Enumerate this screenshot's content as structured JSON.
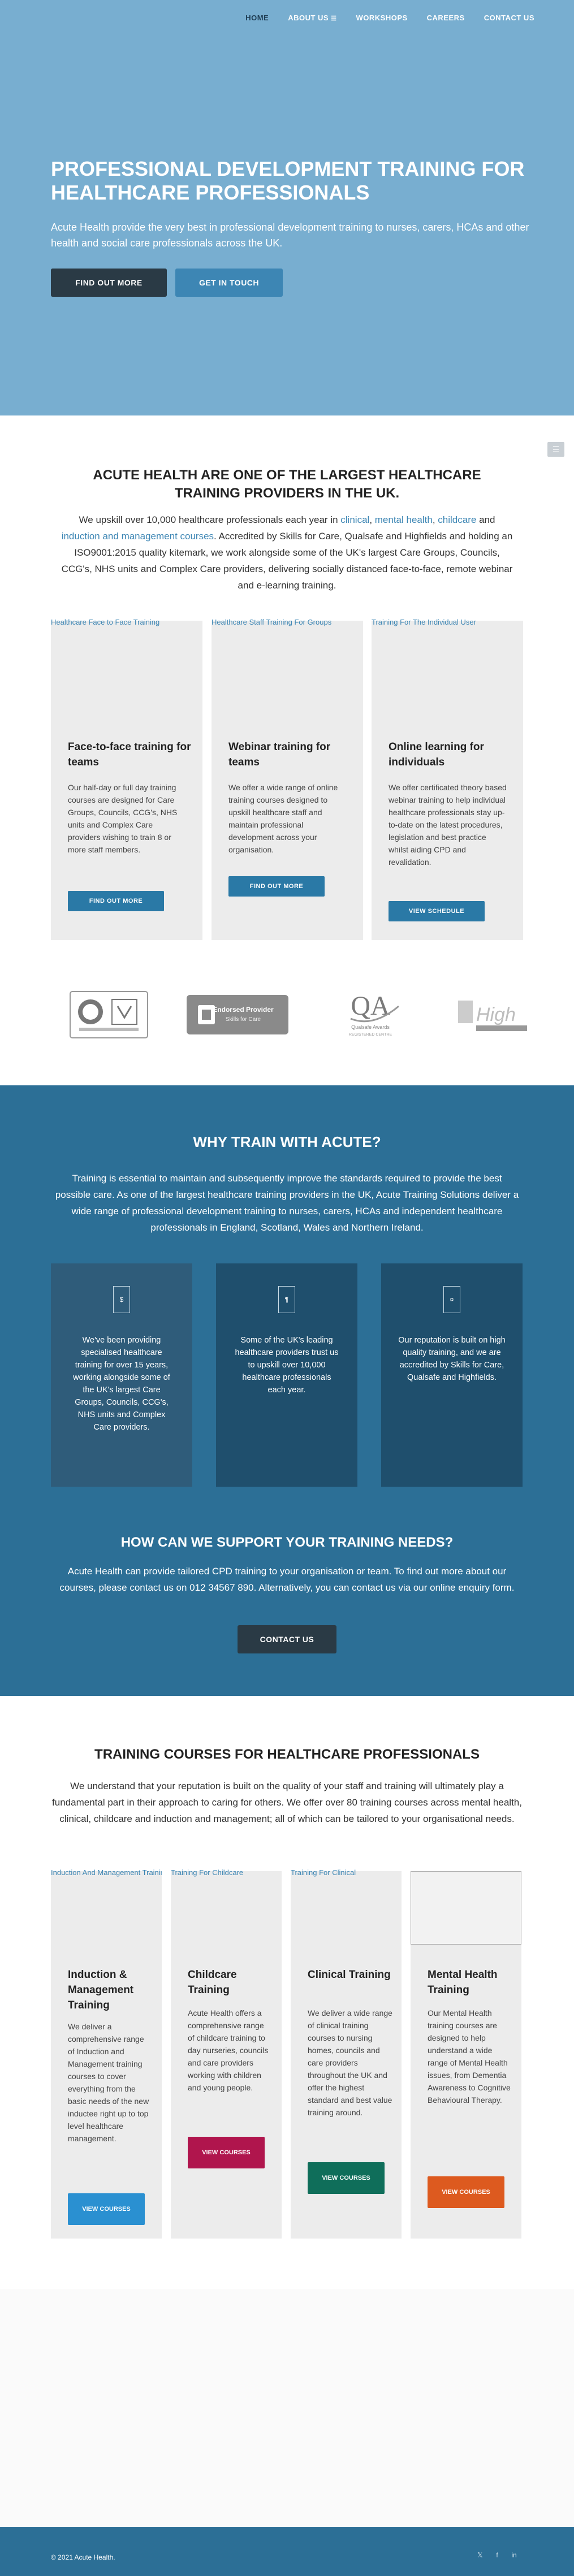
{
  "nav": {
    "items": [
      {
        "label": "HOME"
      },
      {
        "label": "ABOUT US"
      },
      {
        "label": "WORKSHOPS"
      },
      {
        "label": "CAREERS"
      },
      {
        "label": "CONTACT US"
      }
    ]
  },
  "hero": {
    "title": "PROFESSIONAL DEVELOPMENT TRAINING FOR HEALTHCARE PROFESSIONALS",
    "subtitle": "Acute Health provide the very best in professional development training to nurses, carers, HCAs and other health and social care professionals across the UK.",
    "primary_button": "FIND OUT MORE",
    "secondary_button": "GET IN TOUCH"
  },
  "intro": {
    "title": "ACUTE HEALTH ARE ONE OF THE LARGEST HEALTHCARE TRAINING PROVIDERS IN THE UK.",
    "text_1": "We upskill over 10,000 healthcare professionals each year in ",
    "link_clinical": "clinical",
    "sep_1": ", ",
    "link_mental": "mental health",
    "sep_2": ", ",
    "link_childcare": "childcare",
    "text_2": " and ",
    "link_induction": "induction and management courses",
    "text_3": ". Accredited by Skills for Care, Qualsafe and Highfields and holding an ISO9001:2015 quality kitemark, we work alongside some of the UK's largest Care Groups, Councils, CCG's, NHS units and Complex Care providers, delivering socially distanced face-to-face, remote webinar and e-learning training."
  },
  "training_types": [
    {
      "image_alt": "Healthcare Face to Face Training",
      "title": "Face-to-face training for teams",
      "text": "Our half-day or full day training courses are designed for Care Groups, Councils, CCG's, NHS units and Complex Care providers wishing to train 8 or more staff members.",
      "button": "FIND OUT MORE"
    },
    {
      "image_alt": "Healthcare Staff Training For Groups",
      "title": "Webinar training for teams",
      "text": "We offer a wide range of online training courses designed to upskill healthcare staff and maintain professional development across your organisation.",
      "button": "FIND OUT MORE"
    },
    {
      "image_alt": "Training For The Individual User",
      "title": "Online learning for individuals",
      "text": "We offer certificated theory based webinar training to help individual healthcare professionals stay up-to-date on the latest procedures, legislation and best practice whilst aiding CPD and revalidation.",
      "button": "VIEW SCHEDULE"
    }
  ],
  "logos": {
    "endorsed_title": "Endorsed Provider",
    "endorsed_sub": "Skills for Care",
    "qa_text": "QA",
    "qa_sub": "Qualsafe Awards",
    "qa_caption": "REGISTERED CENTRE",
    "highfield_text": "High"
  },
  "why": {
    "title": "WHY TRAIN WITH ACUTE?",
    "text": "Training is essential to maintain and subsequently improve the standards required to provide the best possible care. As one of the largest healthcare training providers in the UK, Acute Training Solutions deliver a wide range of professional development training to nurses, carers, HCAs and independent healthcare professionals in England, Scotland, Wales and Northern Ireland.",
    "boxes": [
      {
        "icon": "$",
        "text": "We've been providing specialised healthcare training for over 15 years, working alongside some of the UK's largest Care Groups, Councils, CCG's, NHS units and Complex Care providers."
      },
      {
        "icon": "¶",
        "text": "Some of the UK's leading healthcare providers trust us to upskill over 10,000 healthcare professionals each year."
      },
      {
        "icon": "¤",
        "text": "Our reputation is built on high quality training, and we are accredited by Skills for Care, Qualsafe and Highfields."
      }
    ]
  },
  "support": {
    "title": "HOW CAN WE SUPPORT YOUR TRAINING NEEDS?",
    "text": "Acute Health can provide tailored CPD training to your organisation or team. To find out more about our courses, please contact us on 012 34567 890. Alternatively, you can contact us via our online enquiry form.",
    "button": "CONTACT US"
  },
  "courses": {
    "title": "TRAINING COURSES FOR HEALTHCARE PROFESSIONALS",
    "text": "We understand that your reputation is built on the quality of your staff and training will ultimately play a fundamental part in their approach to caring for others. We offer over 80 training courses across mental health, clinical, childcare and induction and management; all of which can be tailored to your organisational needs.",
    "items": [
      {
        "image_alt": "Induction And Management Training",
        "title": "Induction & Management Training",
        "text": "We deliver a comprehensive range of Induction and Management training courses to cover everything from the basic needs of the new inductee right up to top level healthcare management.",
        "button": "VIEW COURSES",
        "color": "#2a90d1"
      },
      {
        "image_alt": "Training For Childcare",
        "title": "Childcare Training",
        "text": "Acute Health offers a comprehensive range of childcare training to day nurseries, councils and care providers working with children and young people.",
        "button": "VIEW COURSES",
        "color": "#b0154d"
      },
      {
        "image_alt": "Training For Clinical",
        "title": "Clinical Training",
        "text": "We deliver a wide range of clinical training courses to nursing homes, councils and care providers throughout the UK and offer the highest standard and best value training around.",
        "button": "VIEW COURSES",
        "color": "#0f6e5a"
      },
      {
        "image_alt": "",
        "title": "Mental Health Training",
        "text": "Our Mental Health training courses are designed to help understand a wide range of Mental Health issues, from Dementia Awareness to Cognitive Behavioural Therapy.",
        "button": "VIEW COURSES",
        "color": "#dd5a1f"
      }
    ]
  },
  "footer": {
    "copyright": "© 2021 Acute Health.",
    "social": [
      {
        "icon": "twitter-icon",
        "glyph": "𝕏"
      },
      {
        "icon": "facebook-icon",
        "glyph": "f"
      },
      {
        "icon": "linkedin-icon",
        "glyph": "in"
      }
    ]
  },
  "colors": {
    "hero_bg": "#78aed0",
    "accent": "#3d86b4",
    "dark": "#2a3a45",
    "section_blue": "#2c6f96",
    "box_dark": "#1f4f6d"
  }
}
